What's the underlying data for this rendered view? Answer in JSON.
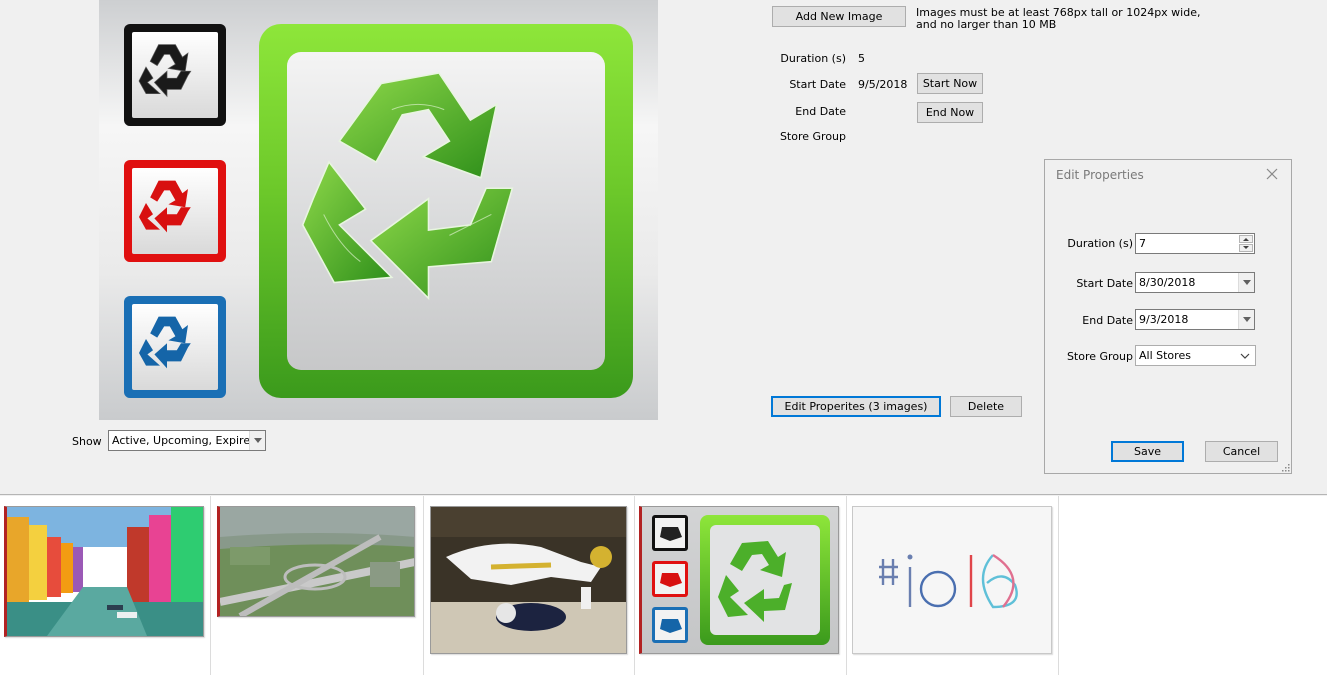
{
  "upload": {
    "add_button": "Add New Image",
    "requirements_line1": "Images must be at least 768px tall or 1024px wide,",
    "requirements_line2": "and no larger than 10 MB"
  },
  "details": {
    "duration_label": "Duration (s)",
    "duration_value": "5",
    "start_label": "Start Date",
    "start_value": "9/5/2018",
    "start_now_button": "Start Now",
    "end_label": "End Date",
    "end_now_button": "End Now",
    "store_group_label": "Store Group"
  },
  "actions": {
    "edit_button": "Edit Properites (3 images)",
    "delete_button": "Delete"
  },
  "filter": {
    "label": "Show",
    "value": "Active, Upcoming, Expired"
  },
  "dialog": {
    "title": "Edit Properties",
    "duration_label": "Duration (s)",
    "duration_value": "7",
    "start_label": "Start Date",
    "start_value": "8/30/2018",
    "end_label": "End Date",
    "end_value": "9/3/2018",
    "store_group_label": "Store Group",
    "store_group_value": "All Stores",
    "save_button": "Save",
    "cancel_button": "Cancel"
  },
  "colors": {
    "accent_focus": "#0078d7",
    "selected_mark": "#b22222",
    "recycle_green": "#4caf2a",
    "recycle_red": "#e01010",
    "recycle_blue": "#1a6fb5"
  },
  "thumbnails": [
    {
      "name": "colorful-canal-houses"
    },
    {
      "name": "highway-interchange-aerial"
    },
    {
      "name": "football-tackle"
    },
    {
      "name": "recycle-signs"
    },
    {
      "name": "io16-logo",
      "text": "#io16"
    }
  ]
}
